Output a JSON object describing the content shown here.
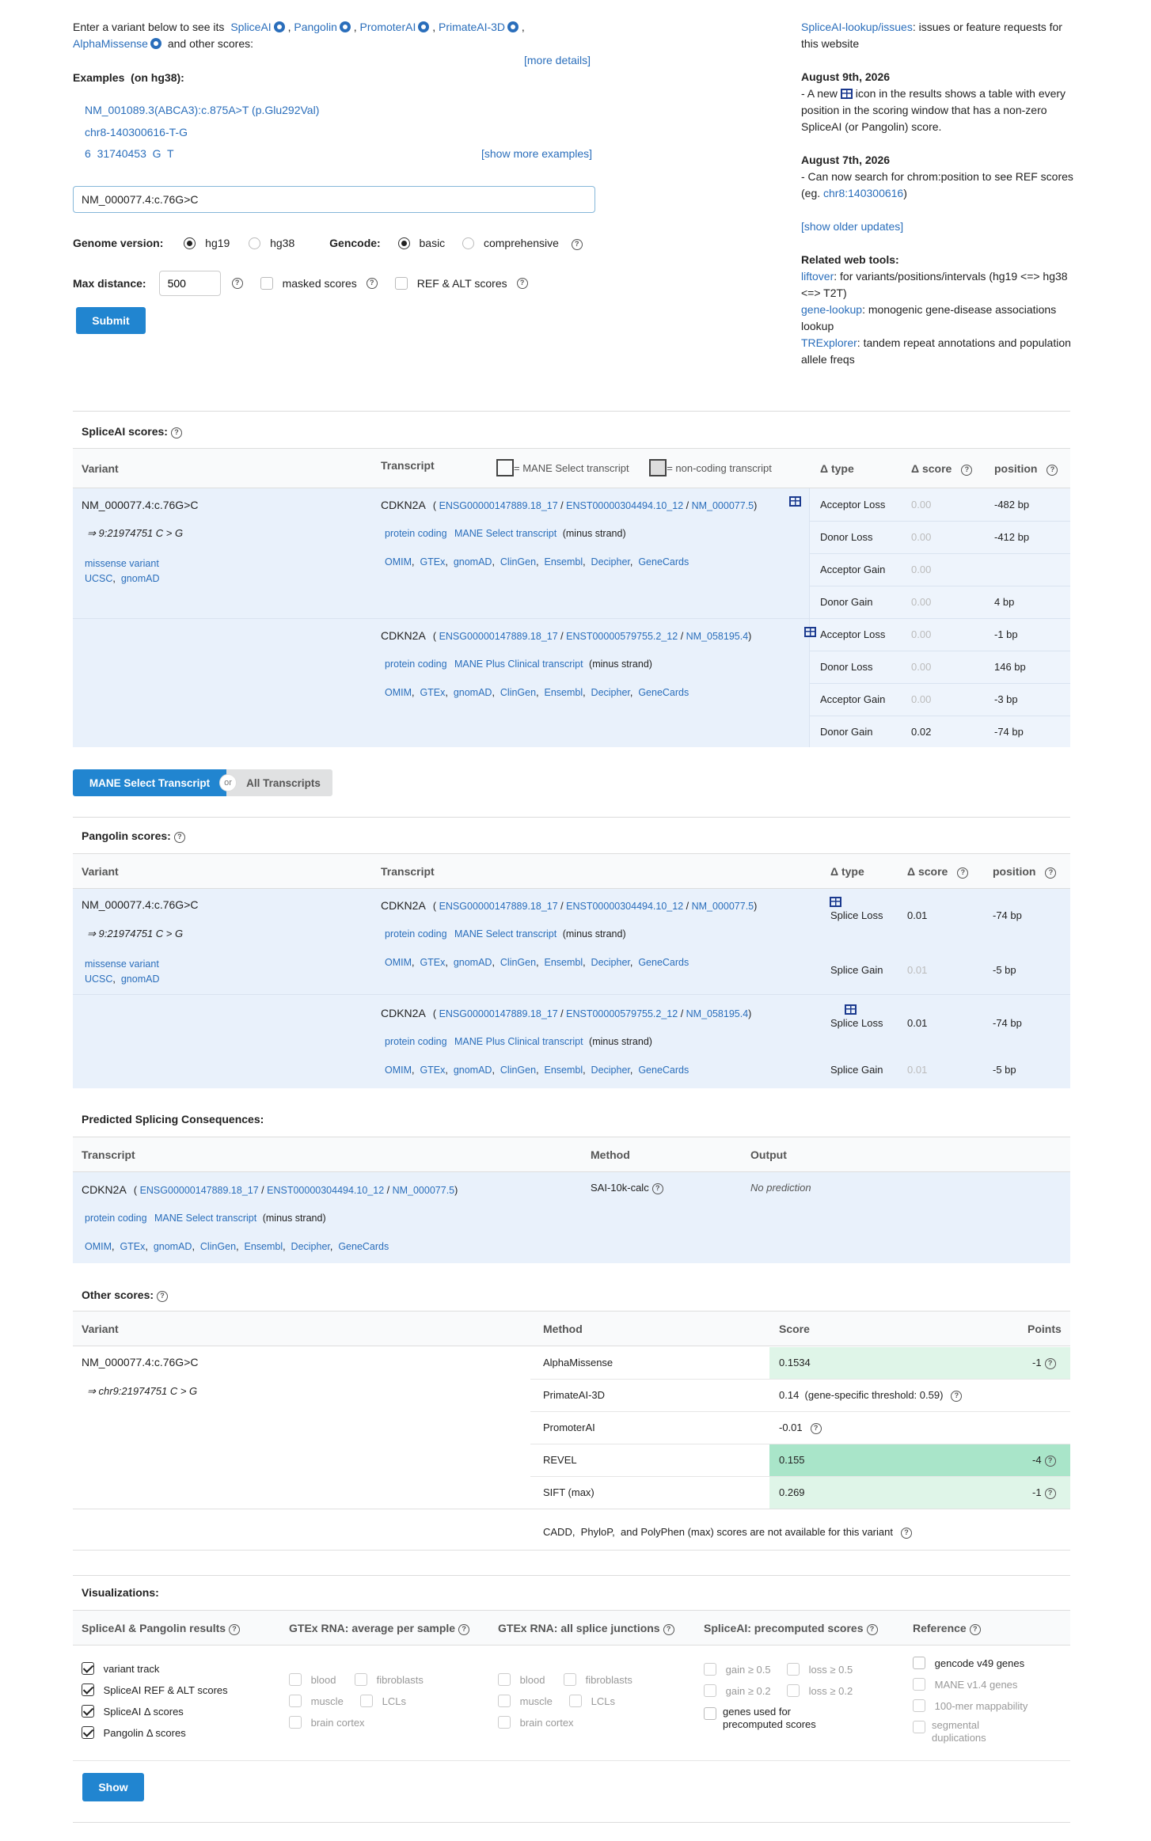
{
  "intro": {
    "prefix": "Enter a variant below to see its",
    "tools": [
      "SpliceAI",
      "Pangolin",
      "PromoterAI",
      "PrimateAI-3D",
      "AlphaMissense"
    ],
    "suffix": "and other scores:",
    "more_details": "[more details]"
  },
  "examples": {
    "title": "Examples  (on hg38):",
    "items": [
      "NM_001089.3(ABCA3):c.875A>T (p.Glu292Val)",
      "chr8-140300616-T-G",
      "6  31740453  G  T"
    ],
    "show_more": "[show more examples]"
  },
  "search": {
    "value": "NM_000077.4:c.76G>C"
  },
  "options": {
    "genome_label": "Genome version:",
    "genome_options": [
      "hg19",
      "hg38"
    ],
    "gencode_label": "Gencode:",
    "gencode_options": [
      "basic",
      "comprehensive"
    ],
    "max_distance_label": "Max distance:",
    "max_distance_value": "500",
    "masked_label": "masked scores",
    "refalt_label": "REF & ALT scores",
    "submit": "Submit"
  },
  "sidebar": {
    "issues_link": "SpliceAI-lookup/issues",
    "issues_text": ": issues or feature requests for this website",
    "updates": [
      {
        "date": "August 9th, 2026",
        "pre": "- A new",
        "post": "icon in the results shows a table with every position in the scoring window that has a non-zero SpliceAI (or Pangolin) score."
      },
      {
        "date": "August 7th, 2026",
        "pre": "- Can now search for chrom:position to see REF scores (eg.",
        "link": "chr8:140300616",
        "post": ")"
      }
    ],
    "show_older": "[show older updates]",
    "related_title": "Related web tools:",
    "related": [
      {
        "link": "liftover",
        "text": ": for variants/positions/intervals (hg19 <=> hg38 <=> T2T)"
      },
      {
        "link": "gene-lookup",
        "text": ": monogenic gene-disease associations lookup"
      },
      {
        "link": "TRExplorer",
        "text": ": tandem repeat annotations and population allele freqs"
      }
    ]
  },
  "spliceai": {
    "title": "SpliceAI scores:",
    "headers": {
      "variant": "Variant",
      "transcript": "Transcript",
      "mane_legend": "= MANE Select transcript",
      "noncoding_legend": "= non-coding transcript",
      "dtype": "Δ type",
      "score": "Δ score",
      "position": "position"
    },
    "variant": {
      "name": "NM_000077.4:c.76G>C",
      "coord": "⇒ 9:21974751 C > G",
      "consequence": "missense variant",
      "links": [
        "UCSC",
        "gnomAD"
      ]
    },
    "transcripts": [
      {
        "gene": "CDKN2A",
        "ids": [
          "ENSG00000147889.18_17",
          "ENST00000304494.10_12",
          "NM_000077.5"
        ],
        "biotype": "protein coding",
        "mane": "MANE Select transcript",
        "strand": "(minus strand)",
        "links": [
          "OMIM",
          "GTEx",
          "gnomAD",
          "ClinGen",
          "Ensembl",
          "Decipher",
          "GeneCards"
        ],
        "scores": [
          [
            "Acceptor Loss",
            "0.00",
            "-482 bp"
          ],
          [
            "Donor Loss",
            "0.00",
            "-412 bp"
          ],
          [
            "Acceptor Gain",
            "0.00",
            ""
          ],
          [
            "Donor Gain",
            "0.00",
            "4 bp"
          ]
        ]
      },
      {
        "gene": "CDKN2A",
        "ids": [
          "ENSG00000147889.18_17",
          "ENST00000579755.2_12",
          "NM_058195.4"
        ],
        "biotype": "protein coding",
        "mane": "MANE Plus Clinical transcript",
        "strand": "(minus strand)",
        "links": [
          "OMIM",
          "GTEx",
          "gnomAD",
          "ClinGen",
          "Ensembl",
          "Decipher",
          "GeneCards"
        ],
        "scores": [
          [
            "Acceptor Loss",
            "0.00",
            "-1 bp"
          ],
          [
            "Donor Loss",
            "0.00",
            "146 bp"
          ],
          [
            "Acceptor Gain",
            "0.00",
            "-3 bp"
          ],
          [
            "Donor Gain",
            "0.02",
            "-74 bp"
          ]
        ]
      }
    ]
  },
  "toggle": {
    "left": "MANE Select Transcript",
    "or": "or",
    "right": "All Transcripts"
  },
  "pangolin": {
    "title": "Pangolin scores:",
    "headers": {
      "variant": "Variant",
      "transcript": "Transcript",
      "dtype": "Δ type",
      "score": "Δ score",
      "position": "position"
    },
    "variant": {
      "name": "NM_000077.4:c.76G>C",
      "coord": "⇒ 9:21974751 C > G",
      "consequence": "missense variant",
      "links": [
        "UCSC",
        "gnomAD"
      ]
    },
    "transcripts": [
      {
        "gene": "CDKN2A",
        "ids": [
          "ENSG00000147889.18_17",
          "ENST00000304494.10_12",
          "NM_000077.5"
        ],
        "biotype": "protein coding",
        "mane": "MANE Select transcript",
        "strand": "(minus strand)",
        "links": [
          "OMIM",
          "GTEx",
          "gnomAD",
          "ClinGen",
          "Ensembl",
          "Decipher",
          "GeneCards"
        ],
        "scores": [
          [
            "Splice Loss",
            "0.01",
            "-74 bp"
          ],
          [
            "Splice Gain",
            "0.01",
            "-5 bp"
          ]
        ]
      },
      {
        "gene": "CDKN2A",
        "ids": [
          "ENSG00000147889.18_17",
          "ENST00000579755.2_12",
          "NM_058195.4"
        ],
        "biotype": "protein coding",
        "mane": "MANE Plus Clinical transcript",
        "strand": "(minus strand)",
        "links": [
          "OMIM",
          "GTEx",
          "gnomAD",
          "ClinGen",
          "Ensembl",
          "Decipher",
          "GeneCards"
        ],
        "scores": [
          [
            "Splice Loss",
            "0.01",
            "-74 bp"
          ],
          [
            "Splice Gain",
            "0.01",
            "-5 bp"
          ]
        ]
      }
    ]
  },
  "consequences": {
    "title": "Predicted Splicing Consequences:",
    "headers": {
      "transcript": "Transcript",
      "method": "Method",
      "output": "Output"
    },
    "row": {
      "gene": "CDKN2A",
      "ids": [
        "ENSG00000147889.18_17",
        "ENST00000304494.10_12",
        "NM_000077.5"
      ],
      "biotype": "protein coding",
      "mane": "MANE Select transcript",
      "strand": "(minus strand)",
      "links": [
        "OMIM",
        "GTEx",
        "gnomAD",
        "ClinGen",
        "Ensembl",
        "Decipher",
        "GeneCards"
      ],
      "method": "SAI-10k-calc",
      "output": "No prediction"
    }
  },
  "other": {
    "title": "Other scores:",
    "headers": {
      "variant": "Variant",
      "method": "Method",
      "score": "Score",
      "points": "Points"
    },
    "variant": {
      "name": "NM_000077.4:c.76G>C",
      "coord": "⇒ chr9:21974751 C > G"
    },
    "rows": [
      {
        "method": "AlphaMissense",
        "score": "0.1534",
        "points": "-1"
      },
      {
        "method": "PrimateAI-3D",
        "score": "0.14  (gene-specific threshold: 0.59)",
        "points": ""
      },
      {
        "method": "PromoterAI",
        "score": "-0.01",
        "points": ""
      },
      {
        "method": "REVEL",
        "score": "0.155",
        "points": "-4"
      },
      {
        "method": "SIFT (max)",
        "score": "0.269",
        "points": "-1"
      }
    ],
    "note": "CADD,  PhyloP,  and PolyPhen (max) scores are not available for this variant"
  },
  "viz": {
    "title": "Visualizations:",
    "columns": [
      {
        "title": "SpliceAI & Pangolin results",
        "items": [
          "variant track",
          "SpliceAI REF & ALT scores",
          "SpliceAI Δ scores",
          "Pangolin Δ scores"
        ]
      },
      {
        "title": "GTEx RNA: average per sample",
        "items": [
          "blood",
          "fibroblasts",
          "muscle",
          "LCLs",
          "brain cortex"
        ]
      },
      {
        "title": "GTEx RNA: all splice junctions",
        "items": [
          "blood",
          "fibroblasts",
          "muscle",
          "LCLs",
          "brain cortex"
        ]
      },
      {
        "title": "SpliceAI: precomputed scores",
        "items": [
          "gain ≥ 0.5",
          "loss ≥ 0.5",
          "gain ≥ 0.2",
          "loss ≥ 0.2",
          "genes used for precomputed scores"
        ]
      },
      {
        "title": "Reference",
        "items": [
          "gencode v49 genes",
          "MANE v1.4 genes",
          "100-mer mappability",
          "segmental duplications"
        ]
      }
    ],
    "show": "Show"
  }
}
